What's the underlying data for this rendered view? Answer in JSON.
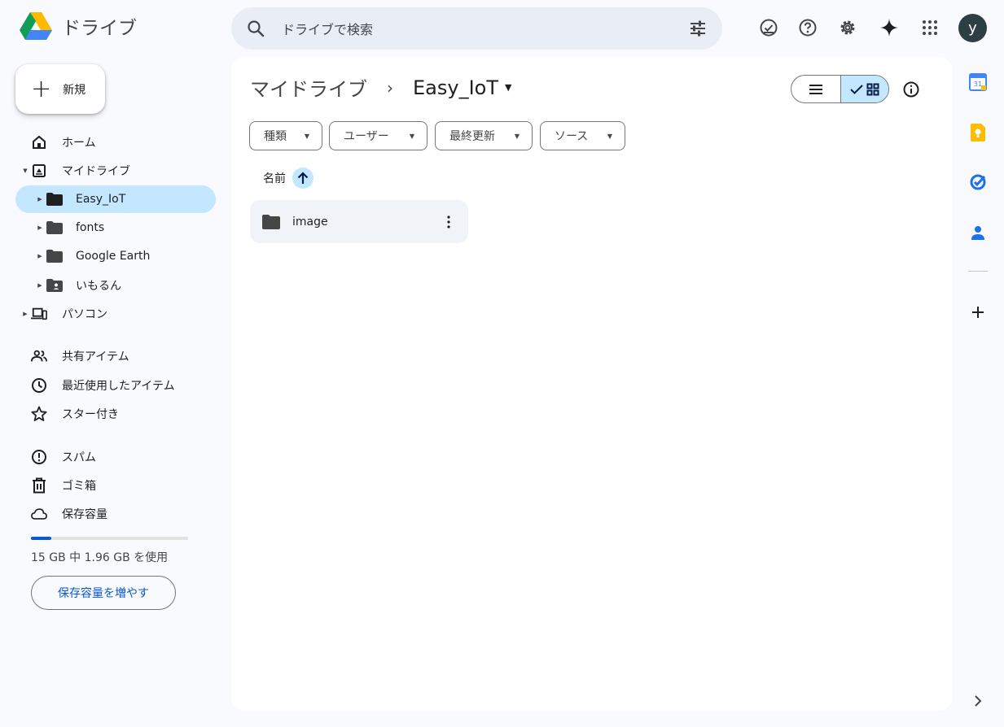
{
  "app": {
    "name": "ドライブ"
  },
  "search": {
    "placeholder": "ドライブで検索"
  },
  "header_icons": [
    "offline-status-icon",
    "help-icon",
    "settings-icon",
    "gemini-icon",
    "apps-icon"
  ],
  "account": {
    "initial": "y",
    "color": "#2d3f45"
  },
  "new_button": {
    "label": "新規"
  },
  "sidebar": {
    "home": "ホーム",
    "my_drive": "マイドライブ",
    "folders": [
      {
        "label": "Easy_IoT",
        "selected": true,
        "icon": "folder-icon"
      },
      {
        "label": "fonts",
        "selected": false,
        "icon": "folder-icon"
      },
      {
        "label": "Google Earth",
        "selected": false,
        "icon": "folder-icon"
      },
      {
        "label": "いもるん",
        "selected": false,
        "icon": "shared-folder-icon"
      }
    ],
    "computers": "パソコン",
    "shared": "共有アイテム",
    "recent": "最近使用したアイテム",
    "starred": "スター付き",
    "spam": "スパム",
    "trash": "ゴミ箱",
    "storage": "保存容量"
  },
  "storage": {
    "usage_text": "15 GB 中 1.96 GB を使用",
    "used_fraction": 0.13,
    "button_label": "保存容量を増やす"
  },
  "breadcrumb": {
    "root": "マイドライブ",
    "current": "Easy_IoT"
  },
  "filters": [
    "種類",
    "ユーザー",
    "最終更新",
    "ソース"
  ],
  "sort": {
    "label": "名前",
    "direction": "ascending"
  },
  "items": [
    {
      "name": "image",
      "type": "folder"
    }
  ],
  "view": {
    "mode": "grid"
  },
  "colors": {
    "accent": "#0b57d0",
    "selected": "#c2e7ff",
    "background": "#f8fafd"
  }
}
